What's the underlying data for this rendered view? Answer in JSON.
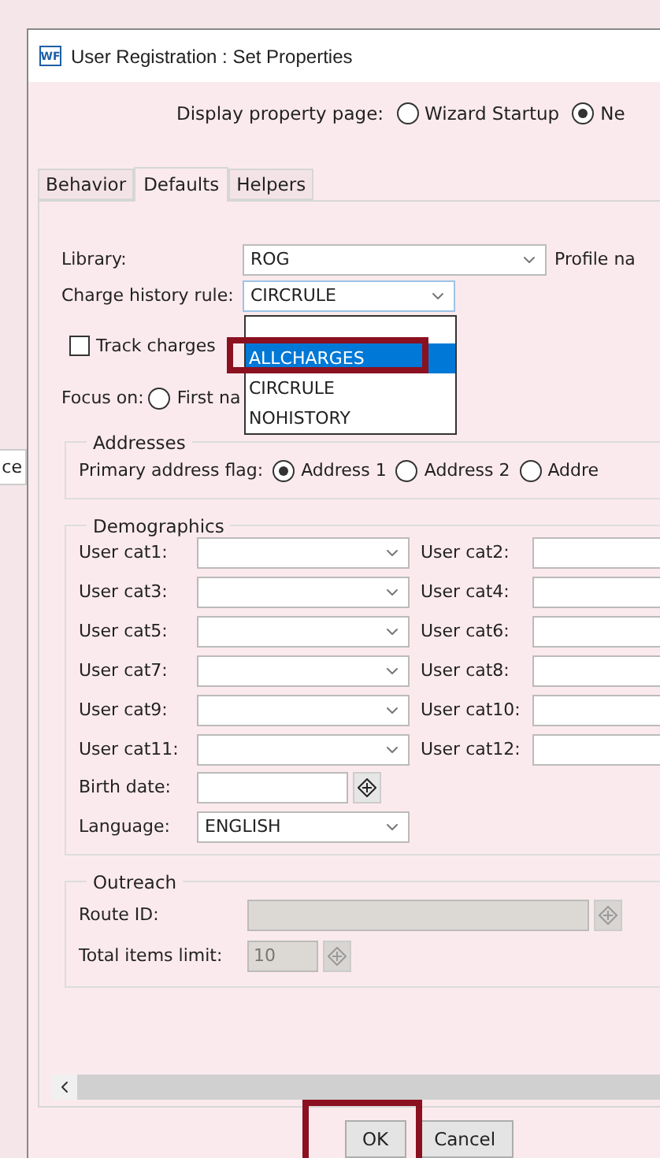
{
  "background_window": {
    "button": "ce"
  },
  "window": {
    "icon": "WF",
    "title": "User Registration : Set Properties"
  },
  "display_property_page": {
    "label": "Display property page:",
    "options": [
      {
        "label": "Wizard Startup",
        "selected": false
      },
      {
        "label": "Ne",
        "selected": true
      }
    ]
  },
  "tabs": [
    {
      "label": "Behavior",
      "selected": false
    },
    {
      "label": "Defaults",
      "selected": true
    },
    {
      "label": "Helpers",
      "selected": false
    }
  ],
  "library": {
    "label": "Library:",
    "value": "ROG",
    "next_label": "Profile na"
  },
  "charge_history_rule": {
    "label": "Charge history rule:",
    "value": "CIRCRULE",
    "dropdown": [
      {
        "label": "ALLCHARGES",
        "highlighted": true,
        "annotated": true
      },
      {
        "label": "CIRCRULE",
        "highlighted": false,
        "annotated": false
      },
      {
        "label": "NOHISTORY",
        "highlighted": false,
        "annotated": false
      }
    ]
  },
  "track_charges": {
    "label": "Track charges",
    "checked": false
  },
  "focus_on": {
    "label": "Focus on:",
    "options": [
      {
        "label": "First na",
        "selected": false
      }
    ]
  },
  "addresses": {
    "legend": "Addresses",
    "label": "Primary address flag:",
    "options": [
      {
        "label": "Address 1",
        "selected": true
      },
      {
        "label": "Address 2",
        "selected": false
      },
      {
        "label": "Addre",
        "selected": false
      }
    ]
  },
  "demographics": {
    "legend": "Demographics",
    "user_cats": [
      {
        "label": "User cat1:",
        "kind": "select"
      },
      {
        "label": "User cat2:",
        "kind": "text"
      },
      {
        "label": "User cat3:",
        "kind": "select"
      },
      {
        "label": "User cat4:",
        "kind": "text"
      },
      {
        "label": "User cat5:",
        "kind": "select"
      },
      {
        "label": "User cat6:",
        "kind": "text"
      },
      {
        "label": "User cat7:",
        "kind": "select"
      },
      {
        "label": "User cat8:",
        "kind": "text"
      },
      {
        "label": "User cat9:",
        "kind": "select"
      },
      {
        "label": "User cat10:",
        "kind": "text"
      },
      {
        "label": "User cat11:",
        "kind": "select"
      },
      {
        "label": "User cat12:",
        "kind": "text"
      }
    ],
    "birth_date": {
      "label": "Birth date:"
    },
    "language": {
      "label": "Language:",
      "value": "ENGLISH"
    }
  },
  "outreach": {
    "legend": "Outreach",
    "route_id": {
      "label": "Route ID:",
      "disabled": true
    },
    "total_items_limit": {
      "label": "Total items limit:",
      "value": "10",
      "disabled": true
    }
  },
  "buttons": [
    {
      "label": "OK",
      "annotated": true
    },
    {
      "label": "Cancel",
      "annotated": false
    }
  ]
}
